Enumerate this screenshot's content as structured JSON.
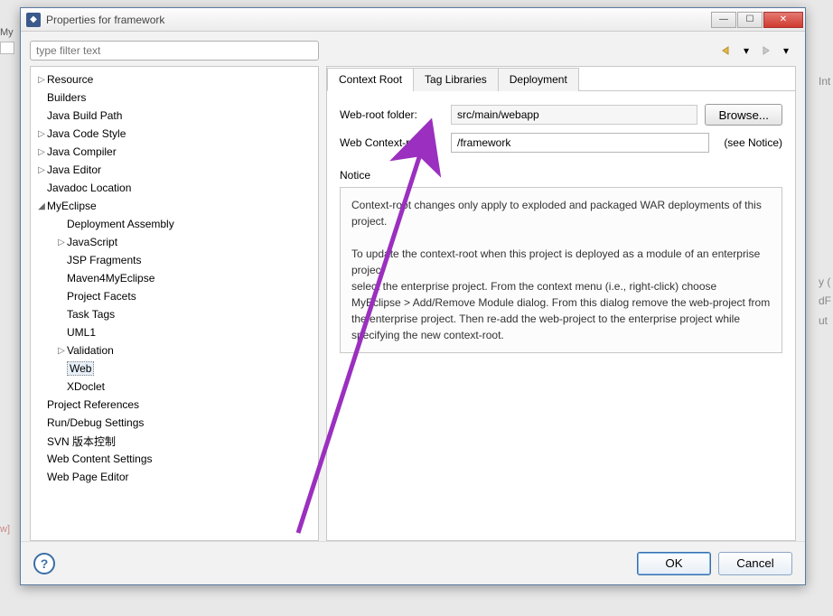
{
  "window": {
    "title": "Properties for framework"
  },
  "filter": {
    "placeholder": "type filter text"
  },
  "tree": [
    {
      "label": "Resource",
      "depth": 1,
      "expander": "▷"
    },
    {
      "label": "Builders",
      "depth": 1,
      "expander": ""
    },
    {
      "label": "Java Build Path",
      "depth": 1,
      "expander": ""
    },
    {
      "label": "Java Code Style",
      "depth": 1,
      "expander": "▷"
    },
    {
      "label": "Java Compiler",
      "depth": 1,
      "expander": "▷"
    },
    {
      "label": "Java Editor",
      "depth": 1,
      "expander": "▷"
    },
    {
      "label": "Javadoc Location",
      "depth": 1,
      "expander": ""
    },
    {
      "label": "MyEclipse",
      "depth": 1,
      "expander": "◢"
    },
    {
      "label": "Deployment Assembly",
      "depth": 2,
      "expander": ""
    },
    {
      "label": "JavaScript",
      "depth": 2,
      "expander": "▷"
    },
    {
      "label": "JSP Fragments",
      "depth": 2,
      "expander": ""
    },
    {
      "label": "Maven4MyEclipse",
      "depth": 2,
      "expander": ""
    },
    {
      "label": "Project Facets",
      "depth": 2,
      "expander": ""
    },
    {
      "label": "Task Tags",
      "depth": 2,
      "expander": ""
    },
    {
      "label": "UML1",
      "depth": 2,
      "expander": ""
    },
    {
      "label": "Validation",
      "depth": 2,
      "expander": "▷"
    },
    {
      "label": "Web",
      "depth": 2,
      "expander": "",
      "selected": true
    },
    {
      "label": "XDoclet",
      "depth": 2,
      "expander": ""
    },
    {
      "label": "Project References",
      "depth": 1,
      "expander": ""
    },
    {
      "label": "Run/Debug Settings",
      "depth": 1,
      "expander": ""
    },
    {
      "label": "SVN 版本控制",
      "depth": 1,
      "expander": ""
    },
    {
      "label": "Web Content Settings",
      "depth": 1,
      "expander": ""
    },
    {
      "label": "Web Page Editor",
      "depth": 1,
      "expander": ""
    }
  ],
  "tabs": [
    {
      "label": "Context Root",
      "active": true
    },
    {
      "label": "Tag Libraries",
      "active": false
    },
    {
      "label": "Deployment",
      "active": false
    }
  ],
  "form": {
    "webroot_label": "Web-root folder:",
    "webroot_value": "src/main/webapp",
    "browse_label": "Browse...",
    "context_label": "Web Context-root",
    "context_value": "/framework",
    "context_suffix": "(see Notice)",
    "notice_label": "Notice",
    "notice_text1": "Context-root changes only apply to exploded and packaged WAR deployments of this project.",
    "notice_text2": "To update the context-root when this project is deployed as a module of an enterprise project",
    "notice_text3": "select the enterprise project. From the context menu (i.e., right-click) choose",
    "notice_text4": "MyEclipse > Add/Remove Module dialog. From this dialog remove the web-project from",
    "notice_text5": "the enterprise project. Then re-add the web-project to the enterprise project while specifying the new context-root."
  },
  "buttons": {
    "help": "?",
    "ok": "OK",
    "cancel": "Cancel"
  },
  "bg": {
    "left1": "My",
    "left2": "w]",
    "r1": "Int",
    "r2": "y (",
    "r3": "dF",
    "r4": "ut"
  }
}
